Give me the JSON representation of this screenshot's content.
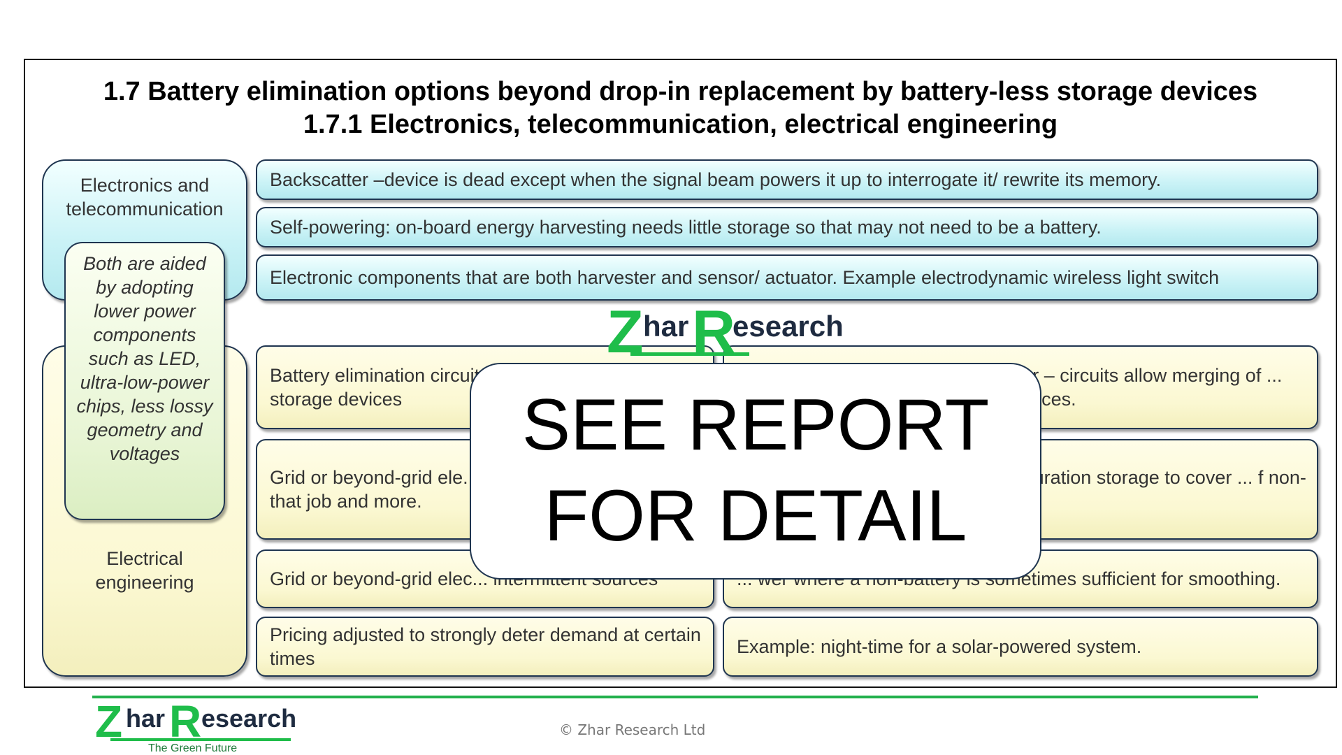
{
  "title": {
    "line1": "1.7 Battery elimination options beyond drop-in replacement by battery-less storage devices",
    "line2": "1.7.1 Electronics, telecommunication, electrical engineering"
  },
  "left": {
    "electronics_label": "Electronics and telecommunication",
    "electrical_label": "Electrical engineering",
    "both_note": "Both are aided by adopting lower power components such as LED, ultra-low-power chips, less lossy geometry and voltages"
  },
  "electronics_rows": [
    "Backscatter –device is dead except when the signal beam powers it up to interrogate it/ rewrite its memory.",
    "Self-powering: on-board energy harvesting needs little storage so that may not need to be a battery.",
    "Electronic components that are both harvester and sensor/ actuator. Example electrodynamic wireless light switch"
  ],
  "electrical_rows": [
    {
      "left": "Battery elimination circuits that allow energy storage devices",
      "right": "Examples: Air drone and electric car – circuits allow merging of ... Circuits may even reduce ... ery suffices."
    },
    {
      "left": "Grid or beyond-grid ele... replaces battery with st... that job and more.",
      "right": "... batteries. With more wind and ... uration storage to cover ... f non-battery storage can"
    },
    {
      "left": "Grid or beyond-grid elec... intermittent sources",
      "right": "... wer where a non-battery is sometimes sufficient for smoothing."
    },
    {
      "left": "Pricing adjusted to strongly deter demand at certain times",
      "right": "Example: night-time for a solar-powered system."
    }
  ],
  "overlay": {
    "line1": "SEE REPORT",
    "line2": "FOR DETAIL"
  },
  "watermark": {
    "z": "Z",
    "har": "har",
    "r": "R",
    "esearch": "esearch"
  },
  "footer": {
    "logo_z": "Z",
    "logo_har": "har",
    "logo_r": "R",
    "logo_esearch": "esearch",
    "tagline": "The Green Future",
    "copyright": "© Zhar Research Ltd"
  },
  "colors": {
    "accent_green": "#1fbd4a",
    "cyan_box": "#c9f2f6",
    "yellow_box": "#fbf8d2",
    "border": "#1f3550"
  }
}
